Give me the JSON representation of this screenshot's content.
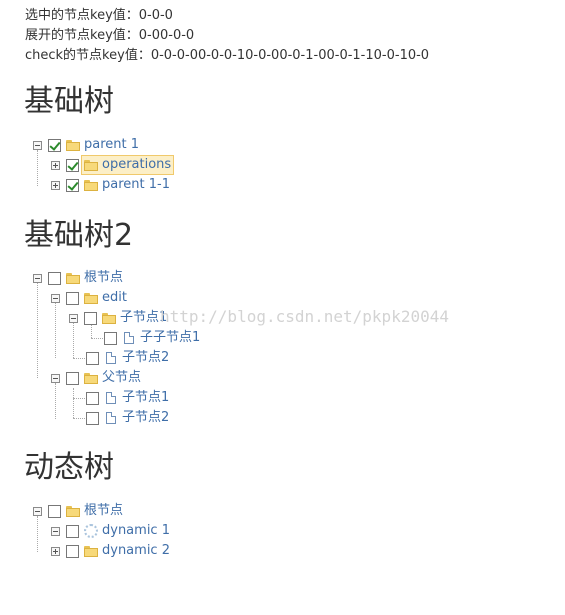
{
  "info": {
    "selected": "选中的节点key值：0-0-0",
    "expanded": "展开的节点key值：0-00-0-0",
    "checked": "check的节点key值：0-0-0-00-0-0-10-0-00-0-1-00-0-1-10-0-10-0"
  },
  "watermark": "http://blog.csdn.net/pkpk20044",
  "tree1": {
    "title": "基础树",
    "root": "parent 1",
    "child1": "operations",
    "child2": "parent 1-1"
  },
  "tree2": {
    "title": "基础树2",
    "root": "根节点",
    "edit": "edit",
    "sub1": "子节点1",
    "subsub1": "子子节点1",
    "sub2": "子节点2",
    "parent": "父节点",
    "p_sub1": "子节点1",
    "p_sub2": "子节点2"
  },
  "tree3": {
    "title": "动态树",
    "root": "根节点",
    "dyn1": "dynamic 1",
    "dyn2": "dynamic 2"
  }
}
